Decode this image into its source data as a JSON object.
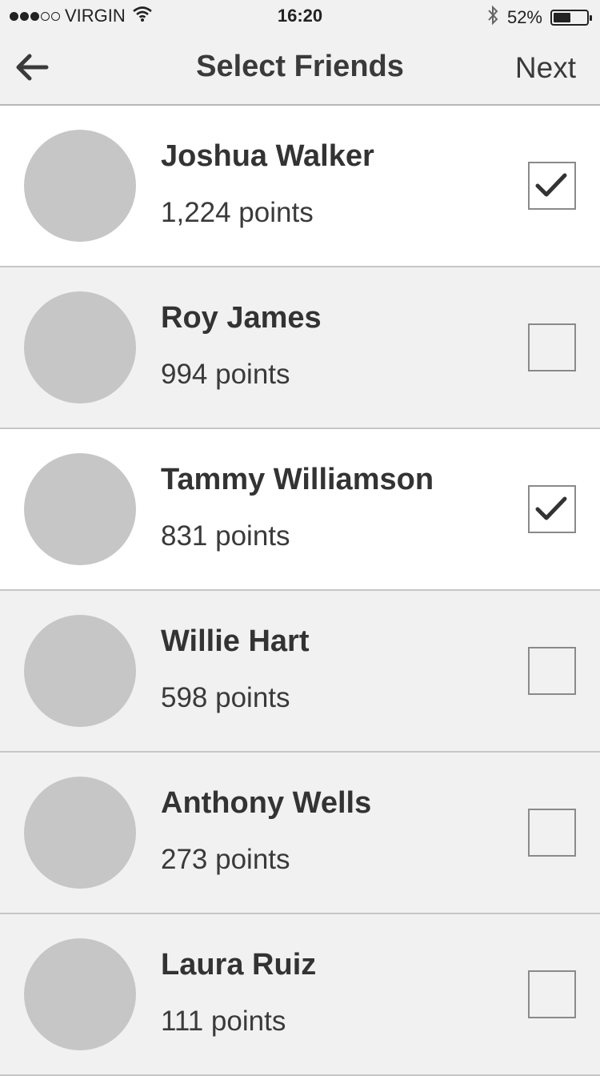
{
  "status_bar": {
    "carrier": "VIRGIN",
    "time": "16:20",
    "battery": "52%",
    "signal_strength": 3,
    "signal_max": 5,
    "battery_level": 0.52,
    "icons": [
      "wifi-icon",
      "bluetooth-icon",
      "battery-icon"
    ]
  },
  "nav": {
    "title": "Select Friends",
    "next_label": "Next",
    "back_icon": "arrow-left-icon"
  },
  "friends": [
    {
      "name": "Joshua Walker",
      "points": "1,224 points",
      "selected": true
    },
    {
      "name": "Roy James",
      "points": "994 points",
      "selected": false
    },
    {
      "name": "Tammy Williamson",
      "points": "831 points",
      "selected": true
    },
    {
      "name": "Willie Hart",
      "points": "598 points",
      "selected": false
    },
    {
      "name": "Anthony Wells",
      "points": "273 points",
      "selected": false
    },
    {
      "name": "Laura Ruiz",
      "points": "111 points",
      "selected": false
    }
  ],
  "colors": {
    "selected_row": "#ffffff",
    "unselected_row": "#f1f1f1",
    "avatar_placeholder": "#c6c6c6",
    "text": "#333333"
  }
}
